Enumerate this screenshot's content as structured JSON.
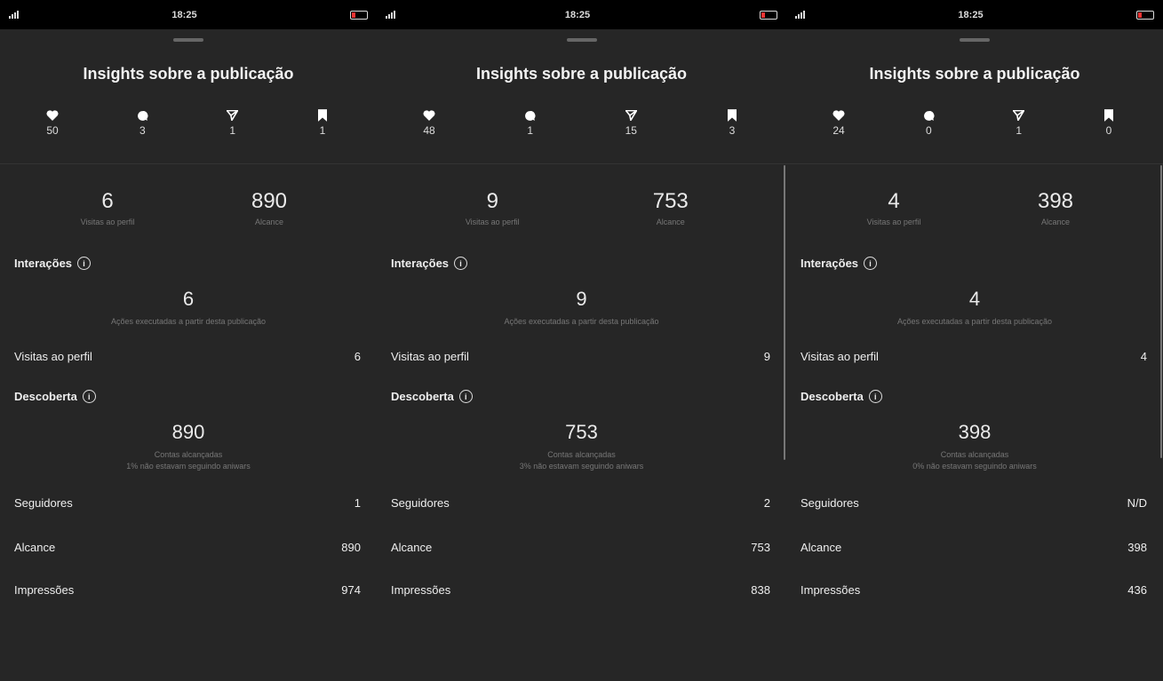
{
  "screens": [
    {
      "status": {
        "time": "18:25"
      },
      "title": "Insights sobre a publicação",
      "stats": {
        "likes": "50",
        "comments": "3",
        "shares": "1",
        "saves": "1"
      },
      "profile_visits": {
        "value": "6",
        "label": "Visitas ao perfil"
      },
      "reach": {
        "value": "890",
        "label": "Alcance"
      },
      "interactions": {
        "heading": "Interações",
        "value": "6",
        "label": "Ações executadas a partir desta publicação"
      },
      "row_profile": {
        "label": "Visitas ao perfil",
        "value": "6"
      },
      "discovery": {
        "heading": "Descoberta",
        "value": "890",
        "label1": "Contas alcançadas",
        "label2": "1% não estavam seguindo aniwars"
      },
      "rows": [
        {
          "label": "Seguidores",
          "value": "1"
        },
        {
          "label": "Alcance",
          "value": "890"
        },
        {
          "label": "Impressões",
          "value": "974"
        }
      ]
    },
    {
      "status": {
        "time": "18:25"
      },
      "title": "Insights sobre a publicação",
      "stats": {
        "likes": "48",
        "comments": "1",
        "shares": "15",
        "saves": "3"
      },
      "profile_visits": {
        "value": "9",
        "label": "Visitas ao perfil"
      },
      "reach": {
        "value": "753",
        "label": "Alcance"
      },
      "interactions": {
        "heading": "Interações",
        "value": "9",
        "label": "Ações executadas a partir desta publicação"
      },
      "row_profile": {
        "label": "Visitas ao perfil",
        "value": "9"
      },
      "discovery": {
        "heading": "Descoberta",
        "value": "753",
        "label1": "Contas alcançadas",
        "label2": "3% não estavam seguindo aniwars"
      },
      "rows": [
        {
          "label": "Seguidores",
          "value": "2"
        },
        {
          "label": "Alcance",
          "value": "753"
        },
        {
          "label": "Impressões",
          "value": "838"
        }
      ]
    },
    {
      "status": {
        "time": "18:25"
      },
      "title": "Insights sobre a publicação",
      "stats": {
        "likes": "24",
        "comments": "0",
        "shares": "1",
        "saves": "0"
      },
      "profile_visits": {
        "value": "4",
        "label": "Visitas ao perfil"
      },
      "reach": {
        "value": "398",
        "label": "Alcance"
      },
      "interactions": {
        "heading": "Interações",
        "value": "4",
        "label": "Ações executadas a partir desta publicação"
      },
      "row_profile": {
        "label": "Visitas ao perfil",
        "value": "4"
      },
      "discovery": {
        "heading": "Descoberta",
        "value": "398",
        "label1": "Contas alcançadas",
        "label2": "0% não estavam seguindo aniwars"
      },
      "rows": [
        {
          "label": "Seguidores",
          "value": "N/D"
        },
        {
          "label": "Alcance",
          "value": "398"
        },
        {
          "label": "Impressões",
          "value": "436"
        }
      ]
    }
  ],
  "icons": {
    "stats": [
      "heart-icon",
      "comment-icon",
      "share-icon",
      "bookmark-icon"
    ],
    "info": "info-icon"
  },
  "colors": {
    "background": "#262626",
    "text": "#ffffff",
    "muted": "#777777"
  }
}
